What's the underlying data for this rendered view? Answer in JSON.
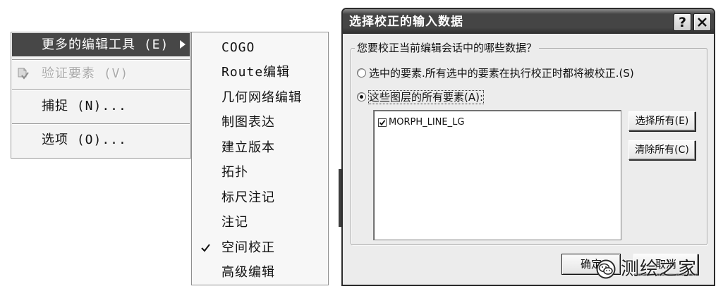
{
  "colors": {
    "menu_background": "#f3f3f3",
    "menu_highlight": "#474747",
    "menu_highlight_text": "#ffffff",
    "disabled_text": "#a9a9a9",
    "title_bar": "#454545",
    "title_text": "#ffffff",
    "dialog_background": "#ececec",
    "text": "#111111",
    "watermark_text": "#1e1e1e"
  },
  "context_menu": {
    "items": [
      {
        "label": "更多的编辑工具 (E)",
        "highlighted": true,
        "has_submenu": true,
        "icon": "submenu-arrow-icon"
      },
      {
        "label": "验证要素 (V)",
        "disabled": true,
        "icon": "validate-features-icon"
      },
      {
        "label": "捕捉 (N)..."
      },
      {
        "label": "选项 (O)..."
      }
    ]
  },
  "submenu": {
    "items": [
      {
        "label": "COGO",
        "checked": false
      },
      {
        "label": "Route编辑",
        "checked": false
      },
      {
        "label": "几何网络编辑",
        "checked": false
      },
      {
        "label": "制图表达",
        "checked": false
      },
      {
        "label": "建立版本",
        "checked": false
      },
      {
        "label": "拓扑",
        "checked": false
      },
      {
        "label": "标尺注记",
        "checked": false
      },
      {
        "label": "注记",
        "checked": false
      },
      {
        "label": "空间校正",
        "checked": true,
        "icon": "checkmark-icon"
      },
      {
        "label": "高级编辑",
        "checked": false
      }
    ]
  },
  "dialog": {
    "title": "选择校正的输入数据",
    "title_bar": {
      "help_glyph": "?",
      "help_icon": "help-icon",
      "close_icon": "close-icon"
    },
    "group_label": "您要校正当前编辑会话中的哪些数据？",
    "options": [
      {
        "label": "选中的要素.所有选中的要素在执行校正时都将被校正.(S)",
        "selected": false
      },
      {
        "label": "这些图层的所有要素(A):",
        "selected": true
      }
    ],
    "layers": [
      {
        "name": "MORPH_LINE_LG",
        "checked": true
      }
    ],
    "buttons": {
      "select_all": "选择所有(E)",
      "clear_all": "清除所有(C)",
      "ok": "确定",
      "cancel": "取消"
    }
  },
  "watermark": {
    "text": "测绘之家",
    "icon": "wechat-icon"
  }
}
